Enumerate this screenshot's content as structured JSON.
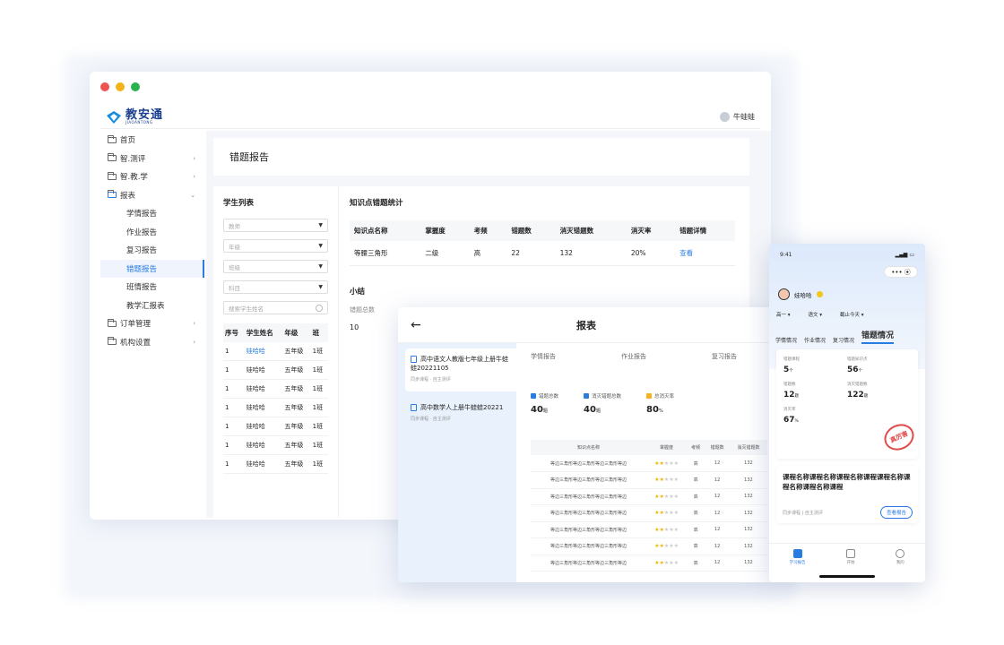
{
  "colors": {
    "accent": "#2a7de0",
    "red_dot": "#ef5350",
    "yellow_dot": "#f5b21c",
    "green_dot": "#2bb24c"
  },
  "desktop": {
    "logo_text": "教安通",
    "logo_sub": "JIAOANTONG",
    "user_name": "牛蛙蛙",
    "nav": [
      {
        "label": "首页",
        "chev": ""
      },
      {
        "label": "智.测评",
        "chev": "›"
      },
      {
        "label": "智.教.学",
        "chev": "›"
      },
      {
        "label": "报表",
        "chev": "⌄"
      }
    ],
    "subnav": [
      "学情报告",
      "作业报告",
      "复习报告",
      "错题报告",
      "班情报告",
      "教学汇报表"
    ],
    "nav_bottom": [
      {
        "label": "订单管理",
        "chev": "›"
      },
      {
        "label": "机构设置",
        "chev": "›"
      }
    ],
    "page_title": "错题报告",
    "student_list_title": "学生列表",
    "selects": [
      "教师",
      "年级",
      "班级",
      "科目"
    ],
    "search_placeholder": "搜索学生姓名",
    "student_headers": [
      "序号",
      "学生姓名",
      "年级",
      "班"
    ],
    "students": [
      [
        "1",
        "娃哈哈",
        "五年级",
        "1班"
      ],
      [
        "1",
        "娃哈哈",
        "五年级",
        "1班"
      ],
      [
        "1",
        "娃哈哈",
        "五年级",
        "1班"
      ],
      [
        "1",
        "娃哈哈",
        "五年级",
        "1班"
      ],
      [
        "1",
        "娃哈哈",
        "五年级",
        "1班"
      ],
      [
        "1",
        "娃哈哈",
        "五年级",
        "1班"
      ],
      [
        "1",
        "娃哈哈",
        "五年级",
        "1班"
      ]
    ],
    "kp_title": "知识点错题统计",
    "kp_headers": [
      "知识点名称",
      "掌握度",
      "考频",
      "错题数",
      "消灭错题数",
      "消灭率",
      "错题详情"
    ],
    "kp_rows": [
      [
        "等腰三角形",
        "二级",
        "高",
        "22",
        "132",
        "20%",
        "查看"
      ]
    ],
    "summary_title": "小结",
    "summary_label": "错题总数",
    "summary_value": "10"
  },
  "tablet": {
    "title": "报表",
    "back": "←",
    "courses": [
      {
        "title": "高中语文人教版七年级上册牛蛙蛙20221105",
        "meta": "同步课程 · 自主测评"
      },
      {
        "title": "高中数学人上册牛蛙蛙20221",
        "meta": "同步课程 · 自主测评"
      }
    ],
    "tabs": [
      "学情报告",
      "作业报告",
      "复习报告"
    ],
    "stats": [
      {
        "label": "错题总数",
        "value": "40",
        "unit": "题",
        "color": "#2a7de0"
      },
      {
        "label": "消灭错题总数",
        "value": "40",
        "unit": "题",
        "color": "#2a7de0"
      },
      {
        "label": "总消灭率",
        "value": "80",
        "unit": "%",
        "color": "#f5b21c"
      }
    ],
    "table_headers": [
      "知识点名称",
      "掌握度",
      "考频",
      "错题数",
      "消灭错题数"
    ],
    "table_row": {
      "name": "等边三角形等边三角形等边三角形等边",
      "freq": "高",
      "wrong": "12",
      "killed": "132",
      "stars": 2
    }
  },
  "phone": {
    "time": "9:41",
    "capsule": "•••  ⦿",
    "user": "娃哈哈",
    "filters": [
      "高一 ▾",
      "语文 ▾",
      "截止今天 ▾"
    ],
    "tabs": [
      "学情情况",
      "作业情况",
      "复习情况",
      "错题情况"
    ],
    "metrics": [
      {
        "label": "错题课程",
        "value": "5",
        "unit": "个"
      },
      {
        "label": "错题知识点",
        "value": "56",
        "unit": "个"
      },
      {
        "label": "错题数",
        "value": "12",
        "unit": "题"
      },
      {
        "label": "消灭错题数",
        "value": "122",
        "unit": "题"
      },
      {
        "label": "消灭率",
        "value": "67",
        "unit": "%"
      }
    ],
    "stamp": "真厉害",
    "course_title": "课程名称课程名称课程名称课程课程名称课程名称课程名称课程",
    "course_meta": "同步课程 | 自主测评",
    "course_button": "查看报告",
    "tabbar": [
      "学习报告",
      "开始",
      "我的"
    ]
  }
}
